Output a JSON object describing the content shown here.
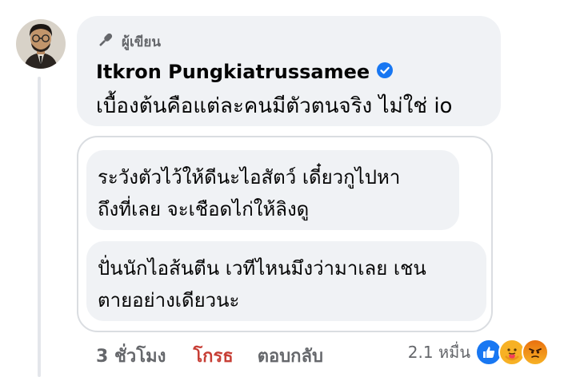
{
  "comment": {
    "author_badge": "ผู้เขียน",
    "author_name": "Itkron Pungkiatrussamee",
    "verified": true,
    "text": "เบื้องต้นคือแต่ละคนมีตัวตนจริง ไม่ใช่ io"
  },
  "quoted_comments": [
    {
      "lines": [
        "ระวังตัวไว้ให้ดีนะไอสัตว์ เดี๋ยวกูไปหา",
        "ถึงที่เลย จะเชือดไก่ให้ลิงดู"
      ]
    },
    {
      "lines": [
        "ปั่นนักไอส้นตีน เวทีไหนมึงว่ามาเลย เชน",
        "ตายอย่างเดียวนะ"
      ]
    }
  ],
  "actions": {
    "timestamp": "3 ชั่วโมง",
    "reaction_label": "โกรธ",
    "reply_label": "ตอบกลับ"
  },
  "reactions": {
    "count": "2.1 หมื่น",
    "icons": [
      "like-icon",
      "care-icon",
      "angry-icon"
    ],
    "colors": {
      "like": "#1877f2",
      "care": "#f7b125",
      "angry": "#e9710f"
    }
  },
  "colors": {
    "bubble": "#f0f2f5",
    "secondary_text": "#65676b",
    "angry_text": "#c73e35",
    "verified": "#1877f2"
  }
}
